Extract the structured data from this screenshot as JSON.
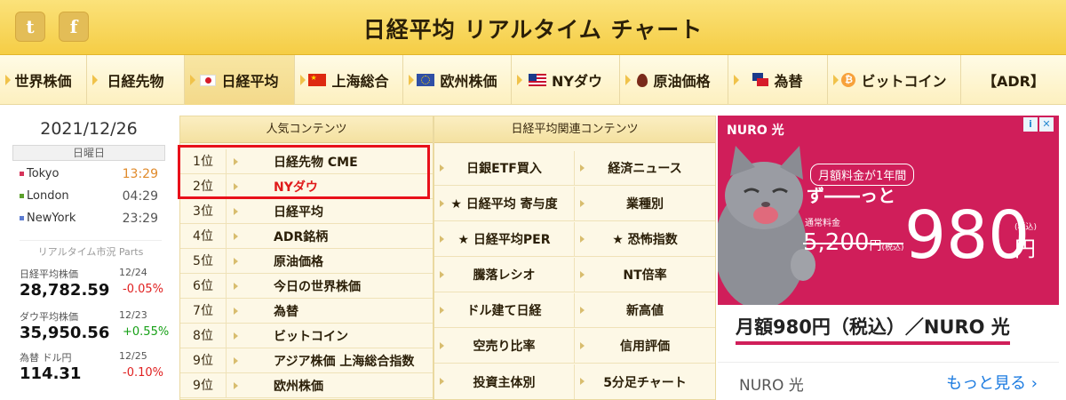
{
  "header": {
    "title": "日経平均 リアルタイム チャート",
    "social": [
      {
        "icon": "twitter-icon",
        "glyph": "t"
      },
      {
        "icon": "facebook-icon",
        "glyph": "f"
      }
    ]
  },
  "nav": {
    "items": [
      {
        "label": "世界株価",
        "icon": ""
      },
      {
        "label": "日経先物",
        "icon": ""
      },
      {
        "label": "日経平均",
        "icon": "japan-flag-icon",
        "active": true
      },
      {
        "label": "上海総合",
        "icon": "china-flag-icon"
      },
      {
        "label": "欧州株価",
        "icon": "eu-flag-icon"
      },
      {
        "label": "NYダウ",
        "icon": "us-flag-icon"
      },
      {
        "label": "原油価格",
        "icon": "oil-drop-icon"
      },
      {
        "label": "為替",
        "icon": "currency-flags-icon"
      },
      {
        "label": "ビットコイン",
        "icon": "bitcoin-icon"
      },
      {
        "label": "【ADR】",
        "icon": ""
      }
    ]
  },
  "market": {
    "date": "2021/12/26",
    "weekday": "日曜日",
    "cities": [
      {
        "name": "Tokyo",
        "time": "13:29",
        "color": "#d6345a"
      },
      {
        "name": "London",
        "time": "04:29",
        "color": "#5ca02c"
      },
      {
        "name": "NewYork",
        "time": "23:29",
        "color": "#5c7bd1"
      }
    ],
    "parts_label": "リアルタイム市況 Parts",
    "quotes": [
      {
        "name": "日経平均株価",
        "date": "12/24",
        "value": "28,782.59",
        "change": "-0.05%",
        "direction": "down"
      },
      {
        "name": "ダウ平均株価",
        "date": "12/23",
        "value": "35,950.56",
        "change": "+0.55%",
        "direction": "up"
      },
      {
        "name": "為替 ドル円",
        "date": "12/25",
        "value": "114.31",
        "change": "-0.10%",
        "direction": "down"
      }
    ]
  },
  "popular": {
    "heading": "人気コンテンツ",
    "items": [
      {
        "rank": "1位",
        "label": "日経先物 CME"
      },
      {
        "rank": "2位",
        "label": "NYダウ",
        "highlight": true
      },
      {
        "rank": "3位",
        "label": "日経平均"
      },
      {
        "rank": "4位",
        "label": "ADR銘柄"
      },
      {
        "rank": "5位",
        "label": "原油価格"
      },
      {
        "rank": "6位",
        "label": "今日の世界株価"
      },
      {
        "rank": "7位",
        "label": "為替"
      },
      {
        "rank": "8位",
        "label": "ビットコイン"
      },
      {
        "rank": "9位",
        "label": "アジア株価 上海総合指数"
      },
      {
        "rank": "9位",
        "label": "欧州株価"
      }
    ]
  },
  "related": {
    "heading": "日経平均関連コンテンツ",
    "items": [
      "日銀ETF買入",
      "経済ニュース",
      "★ 日経平均 寄与度",
      "業種別",
      "★ 日経平均PER",
      "★ 恐怖指数",
      "騰落レシオ",
      "NT倍率",
      "ドル建て日経",
      "新高値",
      "空売り比率",
      "信用評価",
      "投資主体別",
      "5分足チャート"
    ]
  },
  "ad": {
    "logo": "NURO 光",
    "badges": [
      "i",
      "✕"
    ],
    "line1": "月額料金が1年間",
    "line2": "ず――っと",
    "normal_label": "通常料金",
    "old_price": "5,200",
    "old_yen": "円",
    "old_tax": "(税込)",
    "price": "980",
    "price_tax": "(税込)",
    "price_yen": "円",
    "headline": "月額980円（税込）／NURO 光",
    "brand": "NURO 光",
    "more": "もっと見る ›",
    "brand_color": "#d01e5a"
  }
}
